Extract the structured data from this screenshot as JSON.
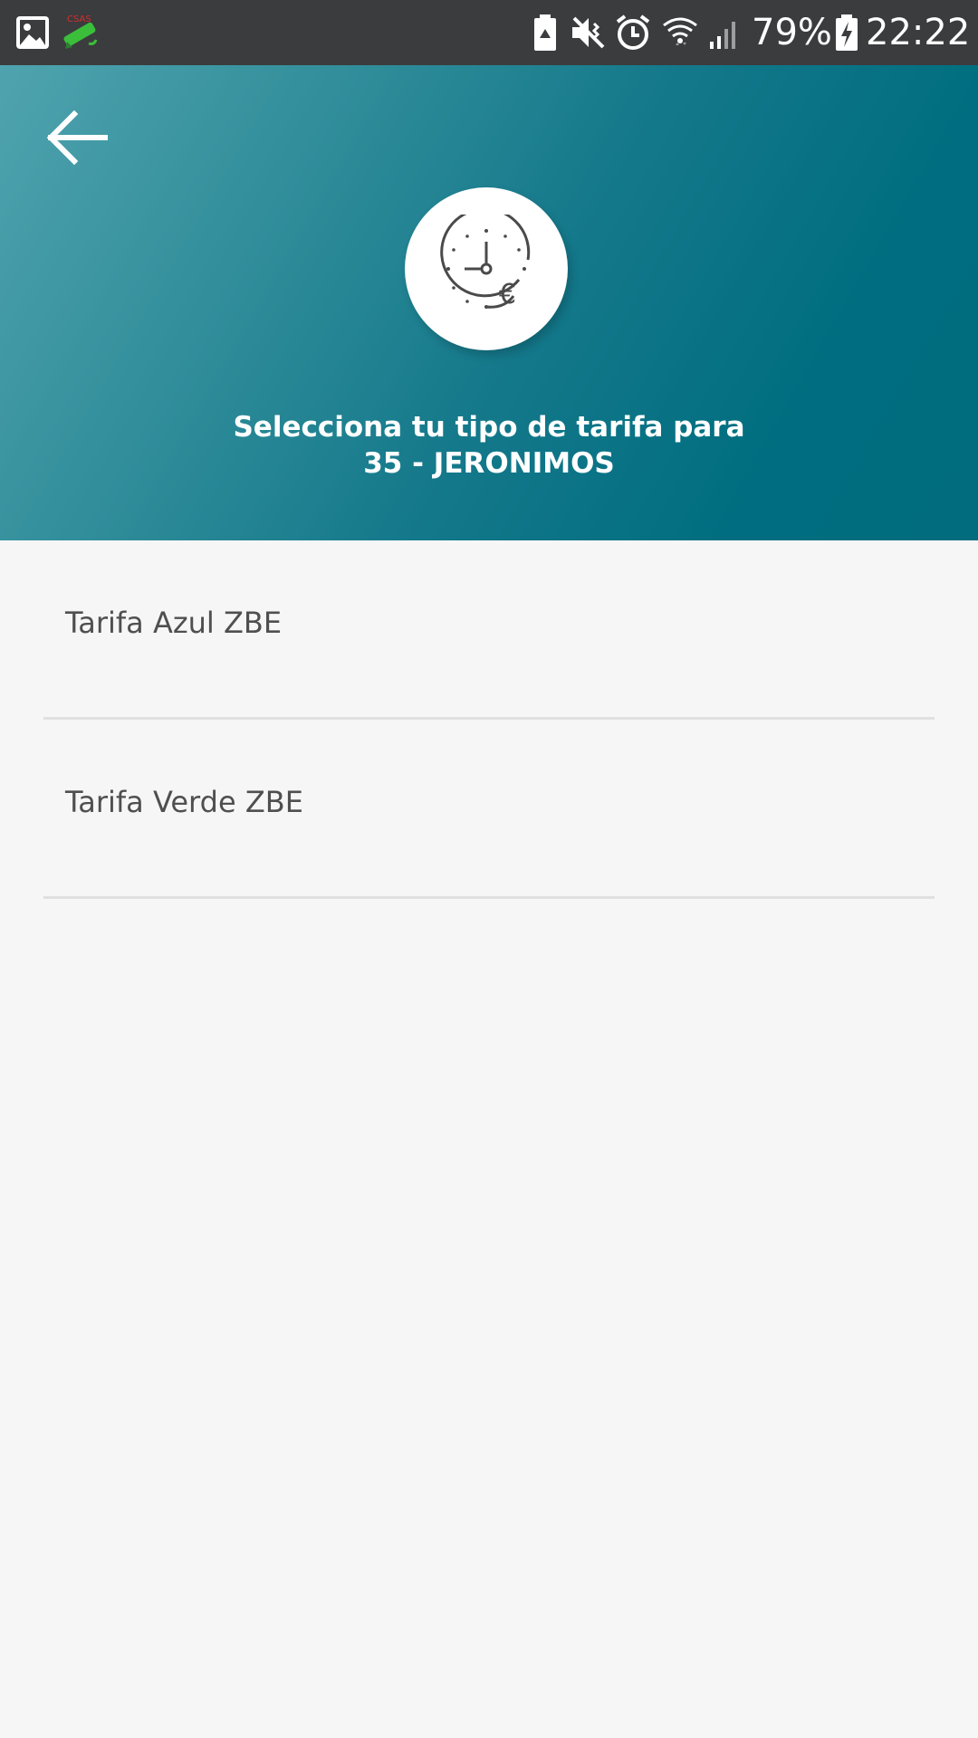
{
  "status_bar": {
    "icons": [
      "gallery-icon",
      "app-notification-icon",
      "battery-saver-icon",
      "vibrate-icon",
      "alarm-icon",
      "wifi-icon",
      "signal-icon",
      "battery-charging-icon"
    ],
    "battery_percent": "79%",
    "time": "22:22"
  },
  "header": {
    "back_icon": "arrow-left-icon",
    "logo_icon": "clock-euro-icon",
    "title_line1": "Selecciona tu tipo de tarifa para",
    "title_line2": "35 - JERONIMOS",
    "gradient_start": "#4fa3ae",
    "gradient_end": "#006c7e"
  },
  "tariffs": [
    {
      "label": "Tarifa Azul ZBE"
    },
    {
      "label": "Tarifa Verde ZBE"
    }
  ],
  "colors": {
    "background": "#f6f6f6",
    "text": "#4f4f4f",
    "divider": "#e0e0e0",
    "status_bar": "#3b3c3e"
  }
}
